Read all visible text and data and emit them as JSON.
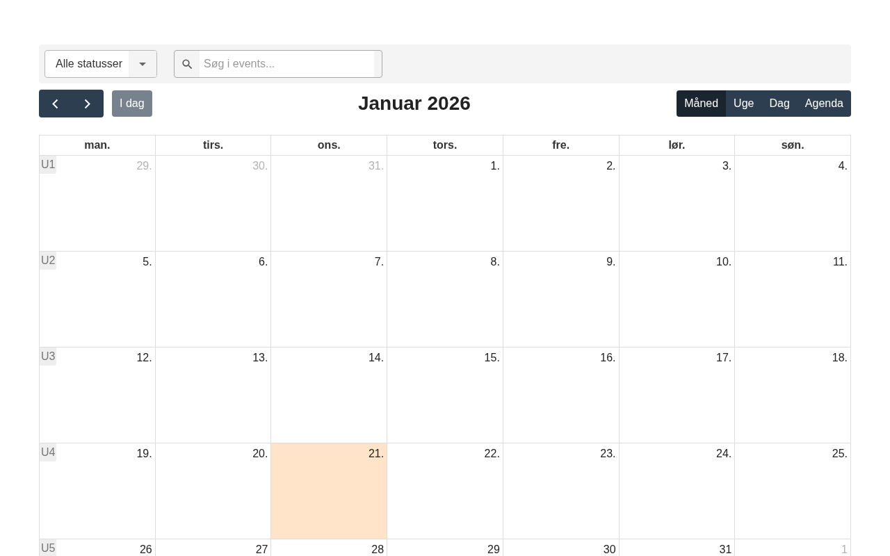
{
  "filters": {
    "status_select": {
      "value": "Alle statusser"
    },
    "search": {
      "placeholder": "Søg i events..."
    }
  },
  "toolbar": {
    "today_button": "I dag",
    "title": "Januar 2026",
    "views": [
      {
        "label": "Måned",
        "selected": true
      },
      {
        "label": "Uge",
        "selected": false
      },
      {
        "label": "Dag",
        "selected": false
      },
      {
        "label": "Agenda",
        "selected": false
      }
    ]
  },
  "calendar": {
    "weekdays": [
      "man.",
      "tirs.",
      "ons.",
      "tors.",
      "fre.",
      "lør.",
      "søn."
    ],
    "weeks": [
      {
        "week": "U1",
        "days": [
          {
            "date": "29.",
            "other_month": true,
            "today": false
          },
          {
            "date": "30.",
            "other_month": true,
            "today": false
          },
          {
            "date": "31.",
            "other_month": true,
            "today": false
          },
          {
            "date": "1.",
            "other_month": false,
            "today": false
          },
          {
            "date": "2.",
            "other_month": false,
            "today": false
          },
          {
            "date": "3.",
            "other_month": false,
            "today": false
          },
          {
            "date": "4.",
            "other_month": false,
            "today": false
          }
        ]
      },
      {
        "week": "U2",
        "days": [
          {
            "date": "5.",
            "other_month": false,
            "today": false
          },
          {
            "date": "6.",
            "other_month": false,
            "today": false
          },
          {
            "date": "7.",
            "other_month": false,
            "today": false
          },
          {
            "date": "8.",
            "other_month": false,
            "today": false
          },
          {
            "date": "9.",
            "other_month": false,
            "today": false
          },
          {
            "date": "10.",
            "other_month": false,
            "today": false
          },
          {
            "date": "11.",
            "other_month": false,
            "today": false
          }
        ]
      },
      {
        "week": "U3",
        "days": [
          {
            "date": "12.",
            "other_month": false,
            "today": false
          },
          {
            "date": "13.",
            "other_month": false,
            "today": false
          },
          {
            "date": "14.",
            "other_month": false,
            "today": false
          },
          {
            "date": "15.",
            "other_month": false,
            "today": false
          },
          {
            "date": "16.",
            "other_month": false,
            "today": false
          },
          {
            "date": "17.",
            "other_month": false,
            "today": false
          },
          {
            "date": "18.",
            "other_month": false,
            "today": false
          }
        ]
      },
      {
        "week": "U4",
        "days": [
          {
            "date": "19.",
            "other_month": false,
            "today": false
          },
          {
            "date": "20.",
            "other_month": false,
            "today": false
          },
          {
            "date": "21.",
            "other_month": false,
            "today": true
          },
          {
            "date": "22.",
            "other_month": false,
            "today": false
          },
          {
            "date": "23.",
            "other_month": false,
            "today": false
          },
          {
            "date": "24.",
            "other_month": false,
            "today": false
          },
          {
            "date": "25.",
            "other_month": false,
            "today": false
          }
        ]
      },
      {
        "week": "U5",
        "days": [
          {
            "date": "26",
            "other_month": false,
            "today": false
          },
          {
            "date": "27",
            "other_month": false,
            "today": false
          },
          {
            "date": "28",
            "other_month": false,
            "today": false
          },
          {
            "date": "29",
            "other_month": false,
            "today": false
          },
          {
            "date": "30",
            "other_month": false,
            "today": false
          },
          {
            "date": "31",
            "other_month": false,
            "today": false
          },
          {
            "date": "1",
            "other_month": true,
            "today": false
          }
        ]
      }
    ]
  }
}
